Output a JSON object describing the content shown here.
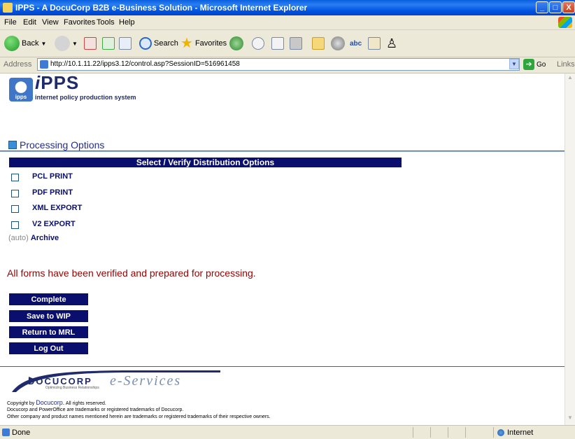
{
  "window": {
    "title": "IPPS - A DocuCorp B2B e-Business Solution - Microsoft Internet Explorer",
    "controls": {
      "minimize": "_",
      "maximize": "□",
      "close": "X"
    }
  },
  "menubar": [
    "File",
    "Edit",
    "View",
    "Favorites",
    "Tools",
    "Help"
  ],
  "toolbar": {
    "back": "Back",
    "search": "Search",
    "favorites": "Favorites"
  },
  "address": {
    "label": "Address",
    "url": "http://10.1.11.22/ipps3.12/control.asp?SessionID=516961458",
    "go": "Go",
    "links": "Links"
  },
  "logo": {
    "mark": "ipps",
    "i": "i",
    "name": "PPS",
    "subtitle": "internet policy production system"
  },
  "section_title": "Processing Options",
  "options_header": "Select / Verify Distribution Options",
  "options": [
    {
      "label": "PCL PRINT",
      "checked": false
    },
    {
      "label": "PDF PRINT",
      "checked": false
    },
    {
      "label": "XML EXPORT",
      "checked": false
    },
    {
      "label": "V2 EXPORT",
      "checked": false
    }
  ],
  "archive": {
    "auto": "(auto)",
    "label": "Archive"
  },
  "message": "All forms have been verified and prepared for processing.",
  "actions": {
    "complete": "Complete",
    "save": "Save to WIP",
    "return": "Return to MRL",
    "logout": "Log Out"
  },
  "footer": {
    "brand": "DOCUCORP",
    "tagline": "Optimizing Business Relationships",
    "eservices": "e-Services",
    "copyright_prefix": "Copyright by",
    "copyright_link": "Docucorp.",
    "copyright_suffix": "All rights reserved.",
    "line2": "Docucorp and PowerOffice are trademarks or registered trademarks of Docucorp.",
    "line3": "Other company and product names mentioned herein are trademarks or registered trademarks of their respective owners."
  },
  "status": {
    "text": "Done",
    "zone": "Internet"
  },
  "colors": {
    "navy": "#0a0f6e",
    "message_red": "#990000",
    "xp_blue": "#0054e3"
  }
}
